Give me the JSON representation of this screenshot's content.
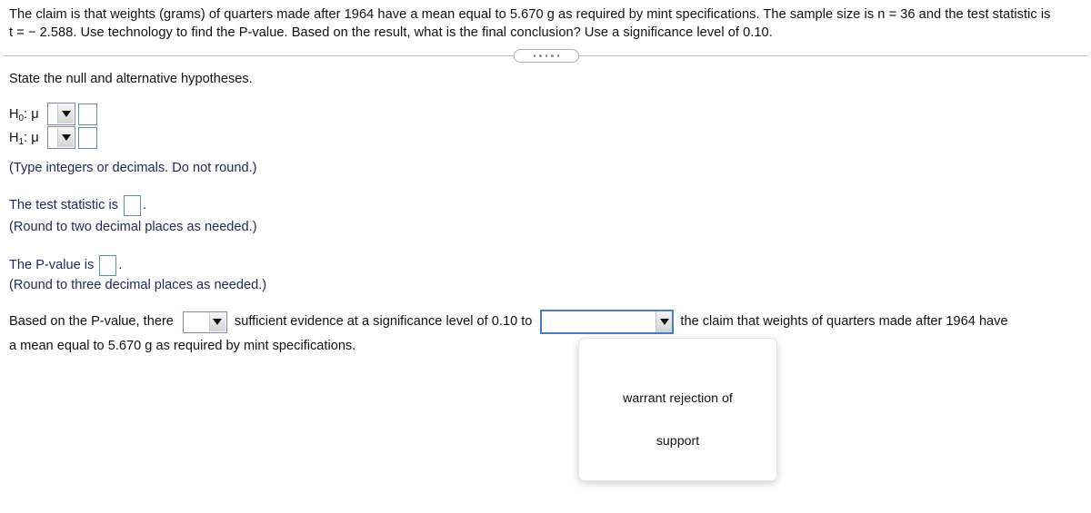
{
  "problem": {
    "text_part1": "The claim is that weights (grams) of quarters made after 1964 have a mean equal to 5.670 g as required by mint specifications. The sample size is ",
    "n_statement": "n = 36",
    "text_part2": " and the test statistic is ",
    "t_statement": "t = − 2.588.",
    "text_part3": " Use technology to find the P-value. Based on the result, what is the final conclusion? Use a significance level of 0.10."
  },
  "divider": {
    "handle_dots": 5
  },
  "hypotheses": {
    "prompt": "State the null and alternative hypotheses.",
    "null_label": "H",
    "null_sub": "0",
    "null_mu": ": μ",
    "alt_label": "H",
    "alt_sub": "1",
    "alt_mu": ": μ",
    "null_select_value": "",
    "null_answer_value": "",
    "alt_select_value": "",
    "alt_answer_value": "",
    "instruction": "(Type integers or decimals. Do not round.)"
  },
  "test_statistic": {
    "label_before": "The test statistic is",
    "value": "",
    "label_after": ".",
    "instruction": "(Round to two decimal places as needed.)"
  },
  "p_value": {
    "label_before": "The P-value is",
    "value": "",
    "label_after": ".",
    "instruction": "(Round to three decimal places as needed.)"
  },
  "conclusion": {
    "text_before": "Based on the P-value, there",
    "evidence_select_value": "",
    "text_middle": "sufficient evidence at a significance level of 0.10 to",
    "claim_select_value": "",
    "text_after": "the claim that weights of quarters made after 1964 have",
    "text_second_line": "a mean equal to 5.670 g as required by mint specifications."
  },
  "dropdown_panel": {
    "options": [
      "warrant rejection of",
      "support"
    ]
  },
  "colors": {
    "body_text": "#111111",
    "answer_text": "#1c2a57",
    "input_border": "#5f8f9c",
    "select_border": "#7a8aa8",
    "focus_border": "#4a7cc0",
    "divider": "#b9b9c2"
  }
}
